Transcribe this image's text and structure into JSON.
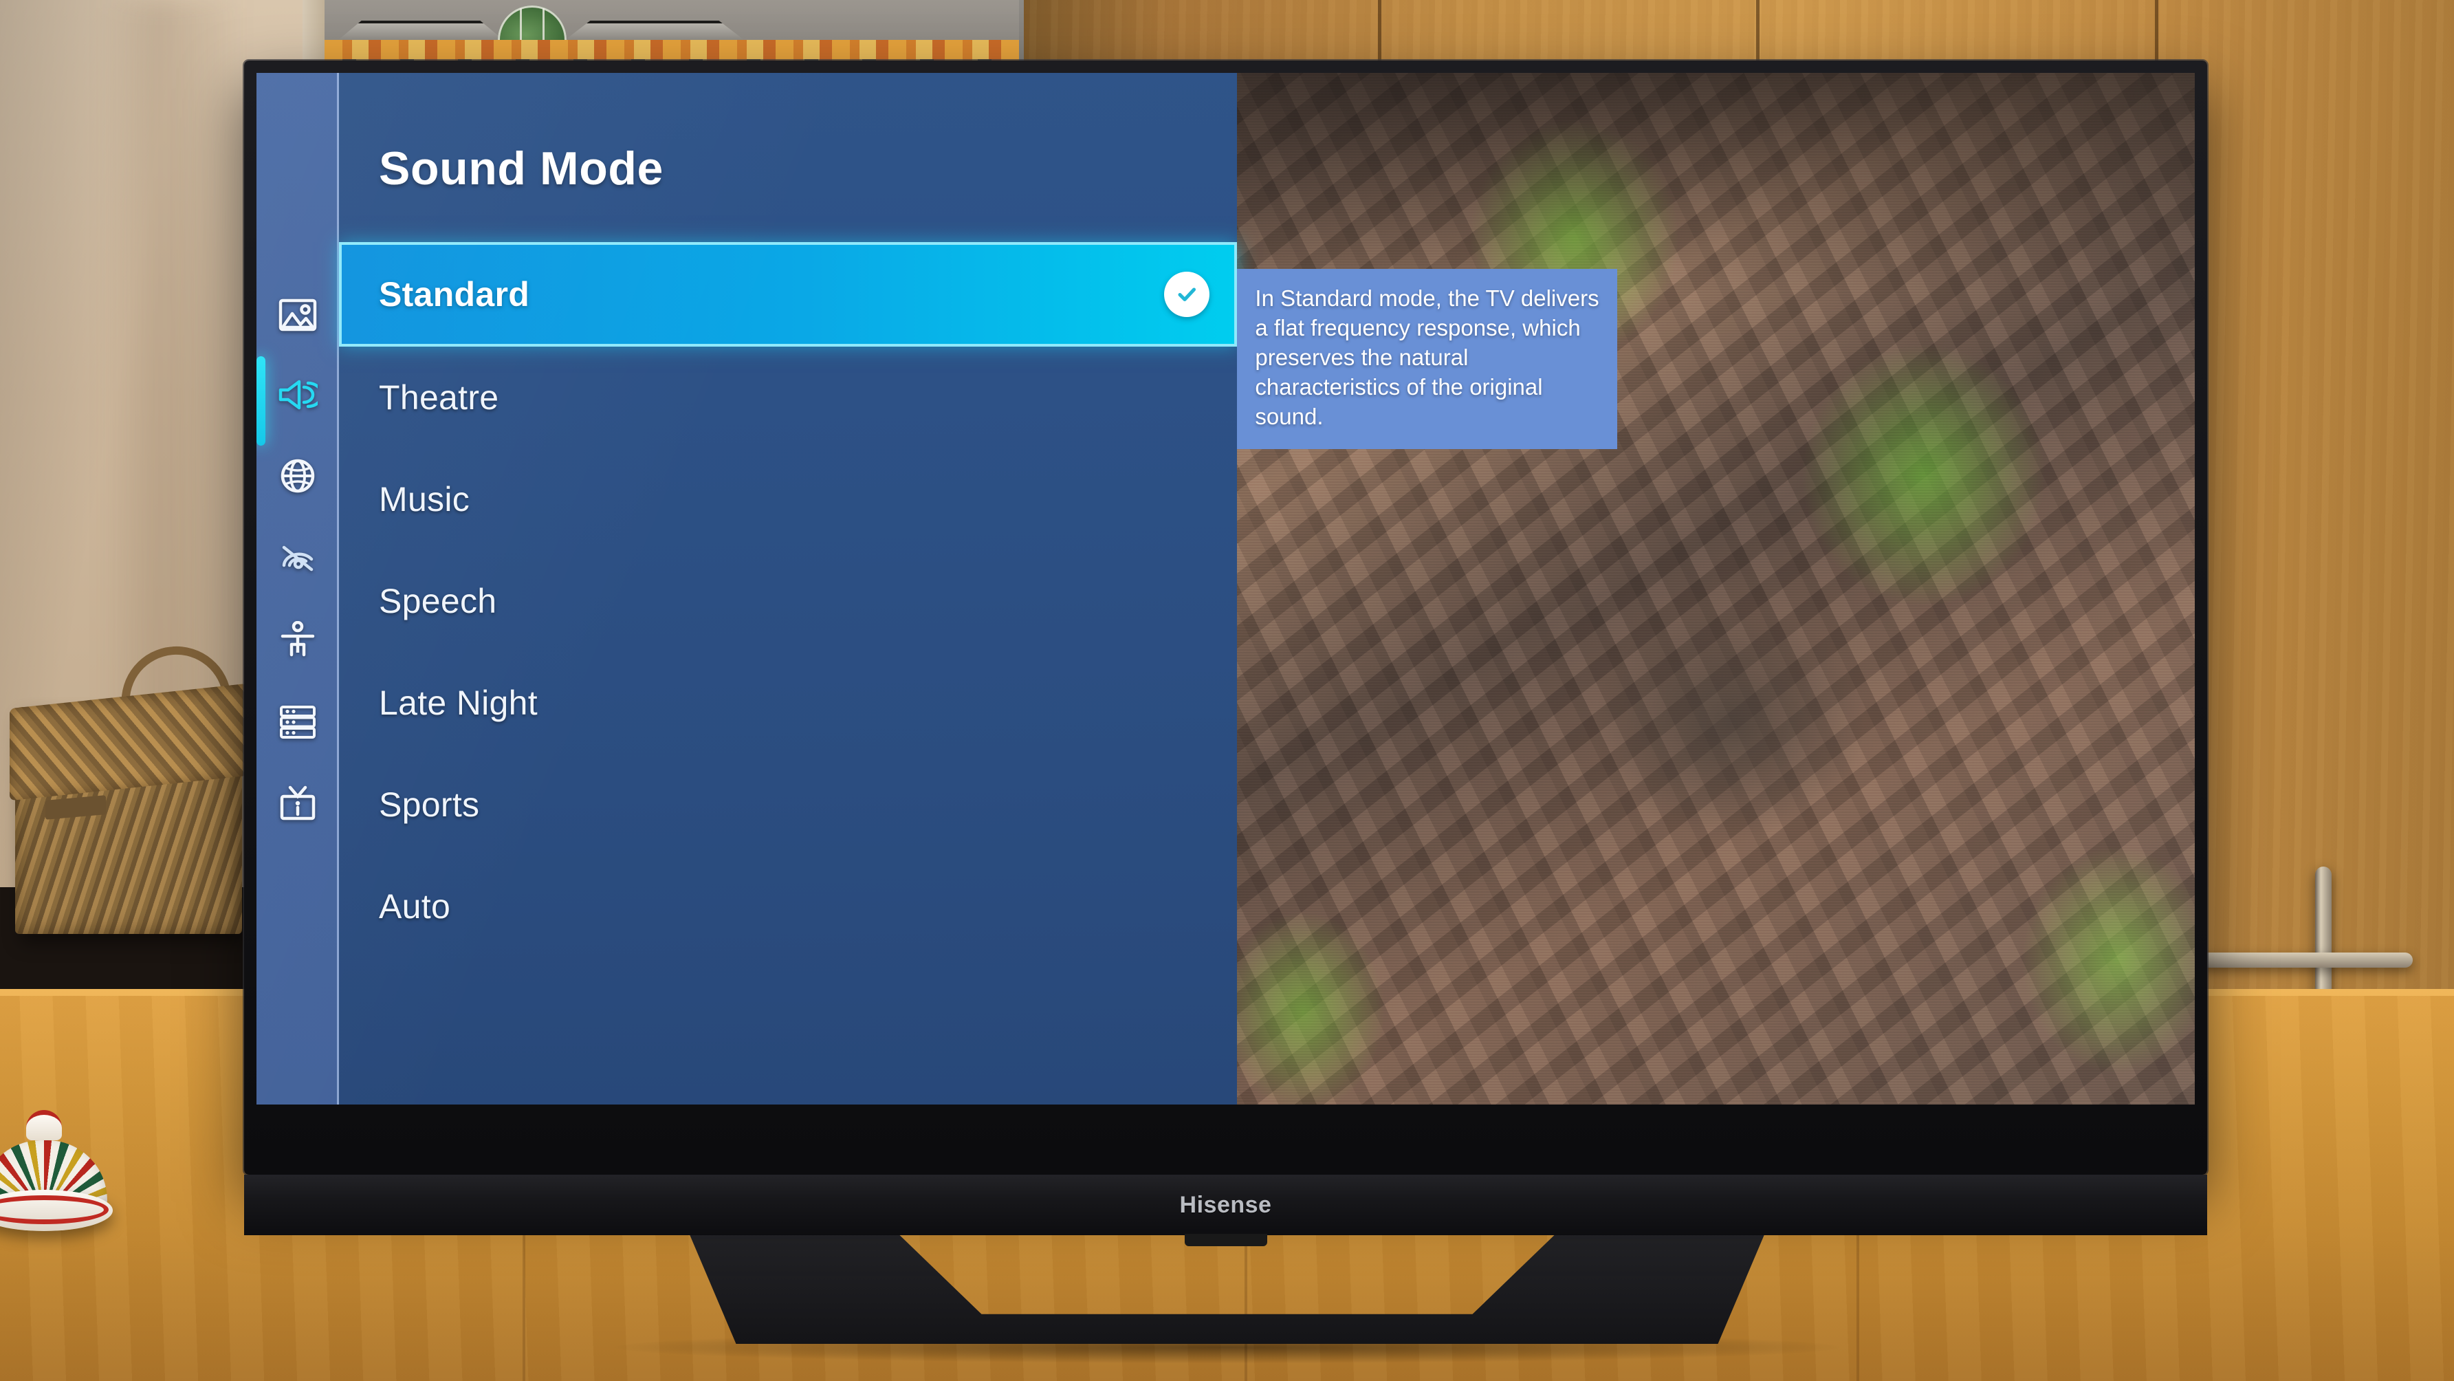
{
  "device": {
    "brand": "Hisense",
    "type": "smart-tv"
  },
  "menu": {
    "title": "Sound Mode",
    "items": [
      {
        "label": "Standard",
        "selected": true,
        "checked": true
      },
      {
        "label": "Theatre",
        "selected": false,
        "checked": false
      },
      {
        "label": "Music",
        "selected": false,
        "checked": false
      },
      {
        "label": "Speech",
        "selected": false,
        "checked": false
      },
      {
        "label": "Late Night",
        "selected": false,
        "checked": false
      },
      {
        "label": "Sports",
        "selected": false,
        "checked": false
      },
      {
        "label": "Auto",
        "selected": false,
        "checked": false
      }
    ]
  },
  "tooltip": {
    "text": "In Standard mode, the TV delivers a flat frequency response, which preserves the natural characteristics of the original sound."
  },
  "sidebar": {
    "active_index": 1,
    "items": [
      {
        "icon": "picture-icon",
        "name": "picture"
      },
      {
        "icon": "sound-icon",
        "name": "sound"
      },
      {
        "icon": "network-globe-icon",
        "name": "network"
      },
      {
        "icon": "no-signal-icon",
        "name": "channel"
      },
      {
        "icon": "accessibility-icon",
        "name": "accessibility"
      },
      {
        "icon": "system-list-icon",
        "name": "system"
      },
      {
        "icon": "tv-info-icon",
        "name": "support"
      }
    ]
  },
  "colors": {
    "panel_blue": "#2d5186",
    "rail_blue": "#4767a0",
    "selection_cyan": "#00cdef",
    "selection_blue": "#0d92de",
    "selection_border": "#8fe9fb",
    "indicator_cyan": "#28e3f7",
    "tooltip_bg": "#6990d6",
    "text_white": "#ffffff"
  }
}
